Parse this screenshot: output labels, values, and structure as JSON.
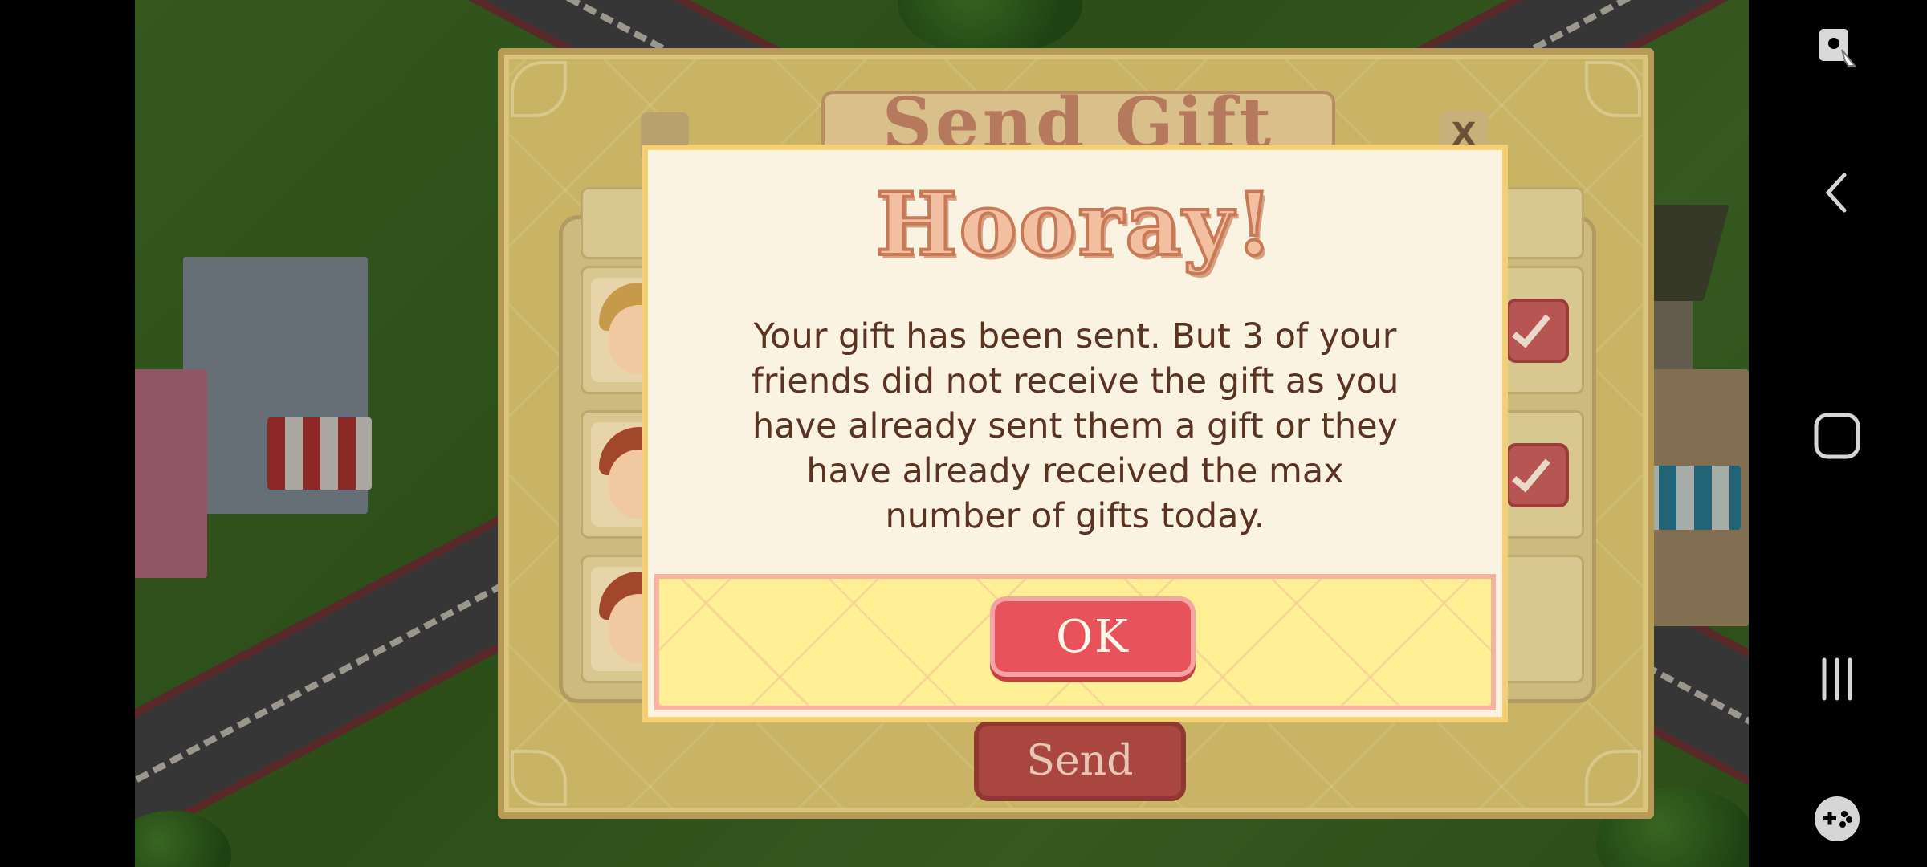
{
  "game": {
    "background_panel": {
      "title": "Send Gift",
      "close_label": "X",
      "send_label": "Send"
    },
    "dialog": {
      "title": "Hooray!",
      "message": "Your gift has been sent. But 3 of your friends did not receive the gift as you have already sent them a gift or they have already received the max number of gifts today.",
      "ok_label": "OK"
    }
  },
  "navbar": {
    "icons": [
      "screen-capture-icon",
      "back-icon",
      "home-icon",
      "recents-icon",
      "game-tools-icon"
    ]
  },
  "colors": {
    "ok_button": "#e8525a",
    "dialog_bg": "#fbf3e2",
    "dialog_border": "#f4cf73",
    "footer_bg": "#fff095"
  }
}
